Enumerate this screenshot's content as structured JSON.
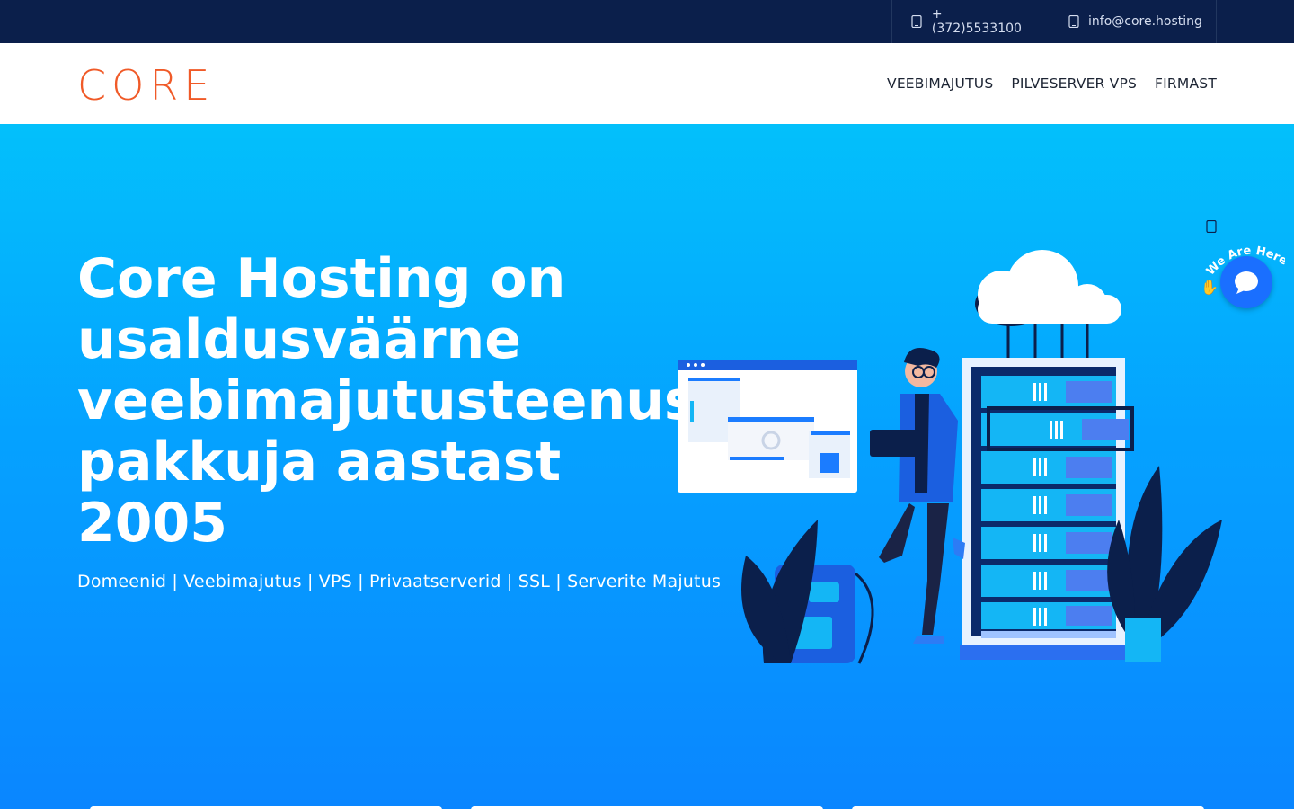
{
  "topbar": {
    "phone": "+(372)5533100",
    "email": "info@core.hosting",
    "phone_icon": "phone-icon",
    "email_icon": "envelope-icon"
  },
  "header": {
    "logo_text": "CORE",
    "nav": [
      {
        "label": "VEEBIMAJUTUS"
      },
      {
        "label": "PILVESERVER VPS"
      },
      {
        "label": "FIRMAST"
      }
    ]
  },
  "hero": {
    "title_lines": [
      "Core Hosting on",
      "usaldusväärne",
      "veebimajutusteenuse",
      "pakkuja aastast",
      "2005"
    ],
    "subtitle": "Domeenid | Veebimajutus | VPS | Privaatserverid | SSL | Serverite Majutus"
  },
  "chat": {
    "badge_text": "We Are Here!",
    "close_icon": "close-icon",
    "bubble_icon": "chat-bubble-icon"
  },
  "colors": {
    "topbar_bg": "#0b1f4b",
    "brand_orange": "#f05a28",
    "hero_top": "#03c0fb",
    "hero_bottom": "#0a86ff"
  }
}
